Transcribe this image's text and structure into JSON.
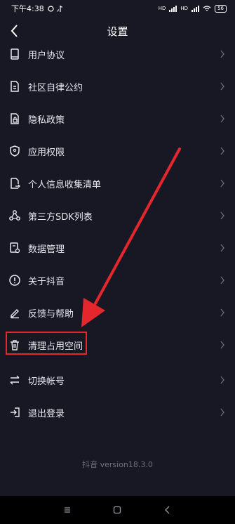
{
  "status_bar": {
    "time": "下午4:38",
    "battery": "56",
    "network": "HD"
  },
  "header": {
    "title": "设置"
  },
  "menu": [
    {
      "label": "用户协议",
      "icon": "book-icon"
    },
    {
      "label": "社区自律公约",
      "icon": "document-icon"
    },
    {
      "label": "隐私政策",
      "icon": "lock-document-icon"
    },
    {
      "label": "应用权限",
      "icon": "shield-icon"
    },
    {
      "label": "个人信息收集清单",
      "icon": "document-export-icon"
    },
    {
      "label": "第三方SDK列表",
      "icon": "share-nodes-icon"
    },
    {
      "label": "数据管理",
      "icon": "data-settings-icon"
    },
    {
      "label": "关于抖音",
      "icon": "info-circle-icon"
    },
    {
      "label": "反馈与帮助",
      "icon": "edit-icon"
    },
    {
      "label": "清理占用空间",
      "icon": "trash-icon"
    },
    {
      "label": "切换帐号",
      "icon": "swap-icon"
    },
    {
      "label": "退出登录",
      "icon": "logout-icon"
    }
  ],
  "version": "抖音 version18.3.0",
  "colors": {
    "background": "#181824",
    "annotation_red": "#e4262d"
  }
}
